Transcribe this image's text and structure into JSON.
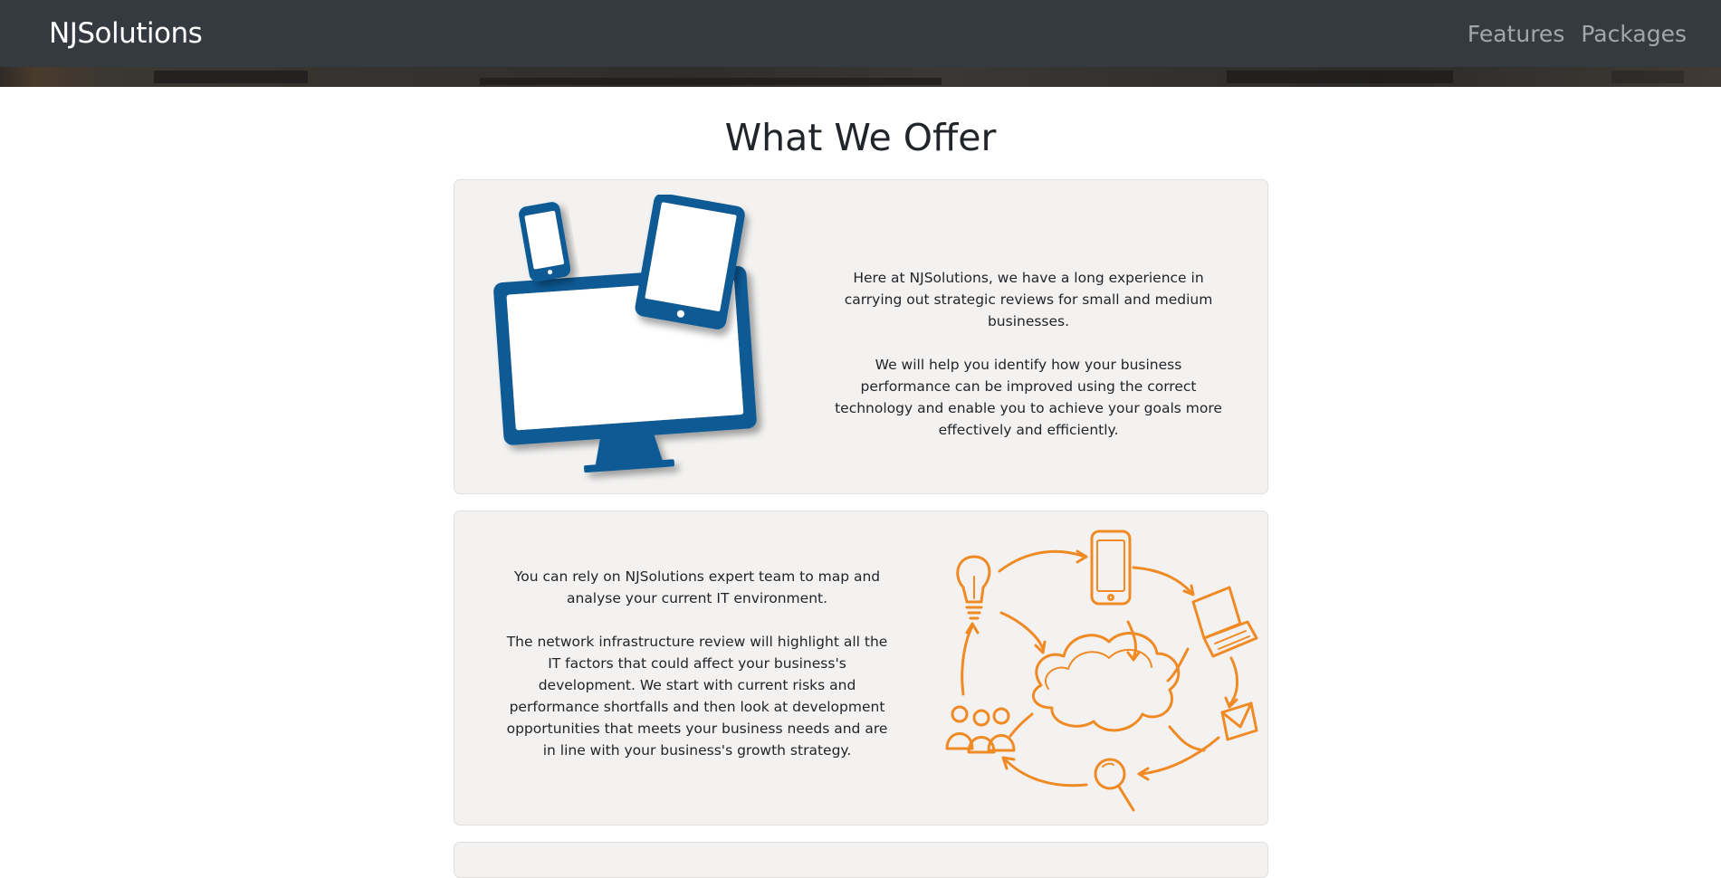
{
  "navbar": {
    "brand": "NJSolutions",
    "links": [
      "Features",
      "Packages"
    ]
  },
  "main": {
    "title": "What We Offer",
    "cards": [
      {
        "illustration": "devices-illustration",
        "paragraphs": [
          "Here at NJSolutions, we have a long experience in carrying out strategic reviews for small and medium businesses.",
          "We will help you identify how your business performance can be improved using the correct technology and enable you to achieve your goals more effectively and efficiently."
        ]
      },
      {
        "illustration": "network-cloud-illustration",
        "paragraphs": [
          "You can rely on NJSolutions expert team to map and analyse your current IT environment.",
          "The network infrastructure review will highlight all the IT factors that could affect your business's development. We start with current risks and performance shortfalls and then look at development opportunities that meets your business needs and are in line with your business's growth strategy."
        ]
      }
    ]
  },
  "colors": {
    "navbar_bg": "#343a40",
    "card_bg": "#f3f2f1",
    "device_blue": "#0d5a95",
    "sketch_orange": "#f08a24"
  }
}
